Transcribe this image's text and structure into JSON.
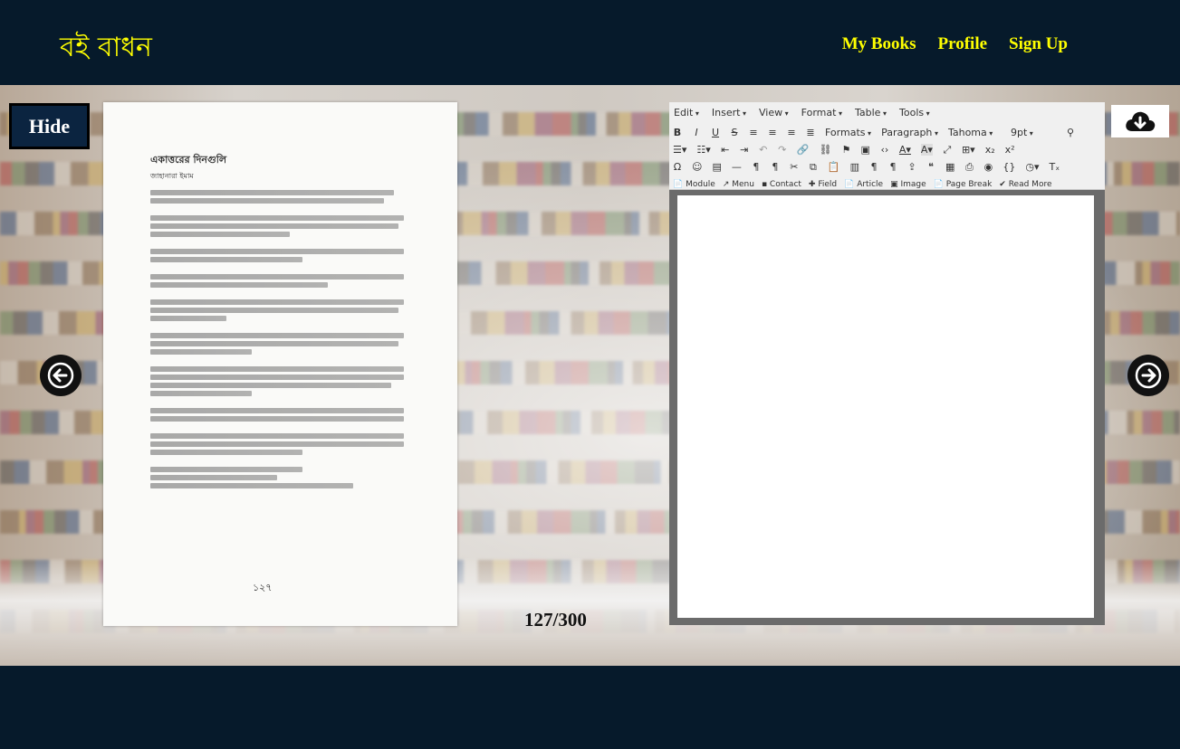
{
  "header": {
    "logo": "বই বাধন",
    "nav": [
      "My Books",
      "Profile",
      "Sign Up"
    ]
  },
  "hide_button": "Hide",
  "book_page": {
    "title": "একাত্তরের দিনগুলি",
    "author": "জাহানারা ইমাম",
    "page_number": "১২৭"
  },
  "counter": "127/300",
  "editor": {
    "menus": [
      "Edit",
      "Insert",
      "View",
      "Format",
      "Table",
      "Tools"
    ],
    "formats_label": "Formats",
    "block_format": "Paragraph",
    "font_family": "Tahoma",
    "font_size": "9pt",
    "row4": [
      "Module",
      "Menu",
      "Contact",
      "Field",
      "Article",
      "Image",
      "Page Break",
      "Read More"
    ]
  },
  "icons": {
    "prev": "arrow-left-icon",
    "next": "arrow-right-icon",
    "download": "cloud-download-icon"
  },
  "colors": {
    "header_bg": "#061a2b",
    "nav_text": "#ffff00",
    "hide_bg": "#0b2440",
    "editor_frame": "#6b6b6b"
  }
}
